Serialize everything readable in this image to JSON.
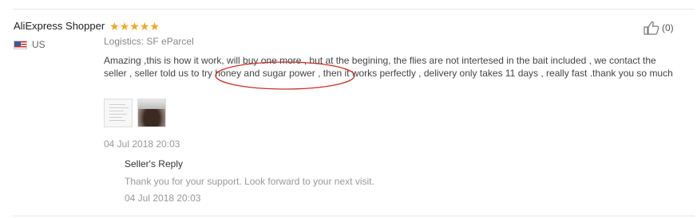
{
  "review": {
    "username": "AliExpress Shopper",
    "rating": 5,
    "country": "US",
    "logistics_label": "Logistics:",
    "logistics_value": "SF eParcel",
    "helpful_count": "(0)",
    "text": "Amazing ,this is how it work, will buy one more , but at the begining, the flies are not intertesed in the bait included , we contact the seller , seller told us to try honey and sugar power , then it works perfectly , delivery only takes 11 days , really fast .thank you so much",
    "date": "04 Jul 2018 20:03"
  },
  "reply": {
    "title": "Seller's Reply",
    "text": "Thank you for your support. Look forward to your next visit.",
    "date": "04 Jul 2018 20:03"
  },
  "colors": {
    "star": "#f5a623",
    "annotation": "#c8302b"
  }
}
